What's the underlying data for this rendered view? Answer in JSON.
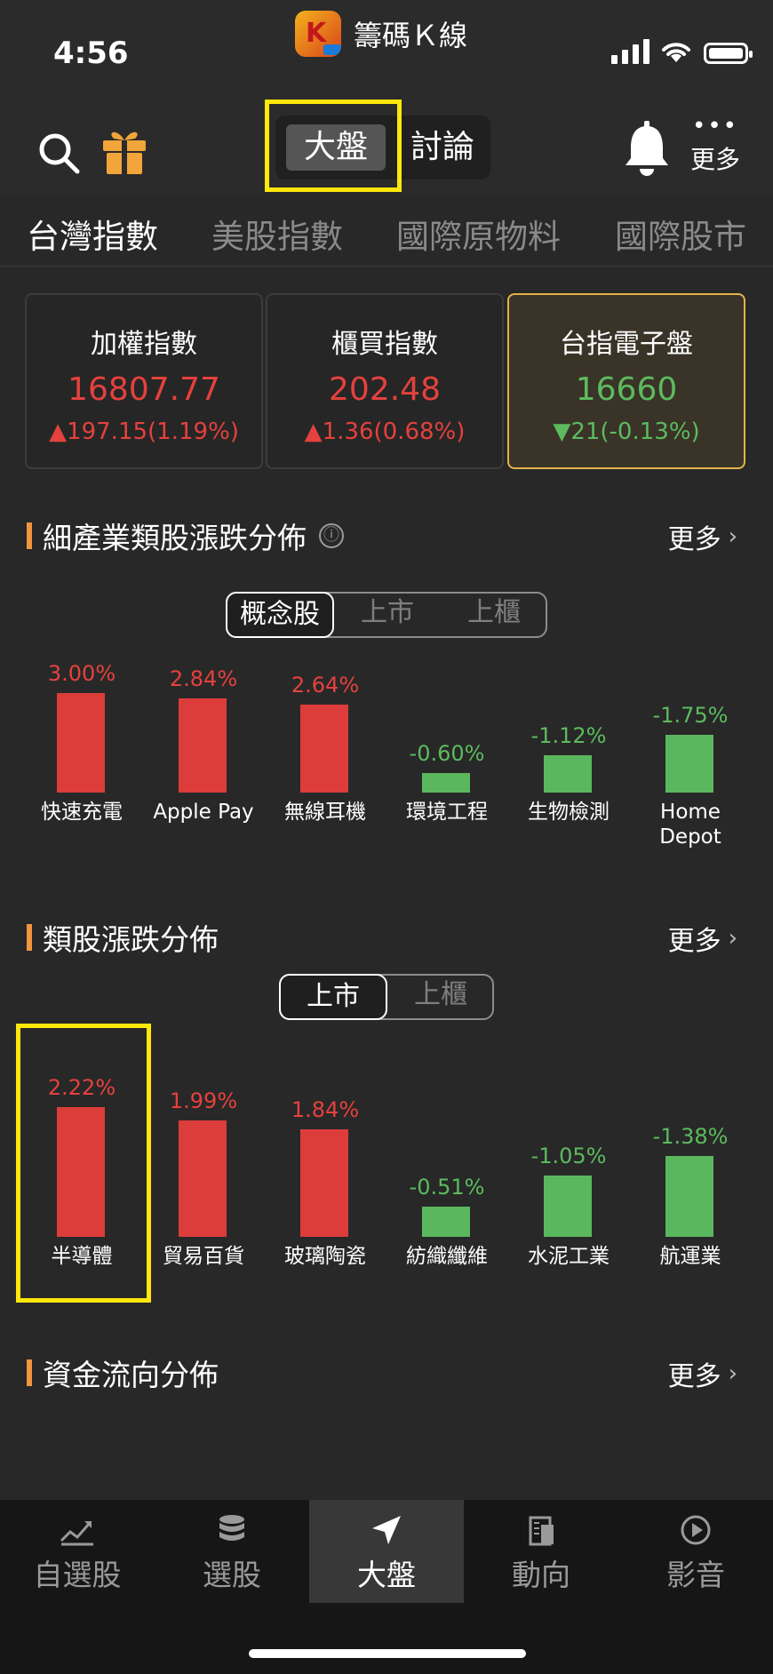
{
  "status": {
    "time": "4:56",
    "app_title": "籌碼Ｋ線",
    "logo_letter": "K"
  },
  "toolbar": {
    "segments": [
      "大盤",
      "討論"
    ],
    "active_segment": "大盤",
    "more_label": "更多",
    "more_dots": "•••"
  },
  "tabs": [
    "台灣指數",
    "美股指數",
    "國際原物料",
    "國際股市"
  ],
  "active_tab": "台灣指數",
  "index_cards": [
    {
      "name": "加權指數",
      "value": "16807.77",
      "change": "▲197.15(1.19%)",
      "direction": "up"
    },
    {
      "name": "櫃買指數",
      "value": "202.48",
      "change": "▲1.36(0.68%)",
      "direction": "up"
    },
    {
      "name": "台指電子盤",
      "value": "16660",
      "change": "▼21(-0.13%)",
      "direction": "down",
      "selected": true
    }
  ],
  "sub_industry": {
    "title": "細產業類股漲跌分佈",
    "info_icon": "ⓘ",
    "more": "更多",
    "chevron": "›",
    "segments": [
      "概念股",
      "上市",
      "上櫃"
    ],
    "active_segment": "概念股",
    "bars": [
      {
        "label": "快速充電",
        "pct": "3.00%",
        "value": 3.0
      },
      {
        "label": "Apple Pay",
        "pct": "2.84%",
        "value": 2.84
      },
      {
        "label": "無線耳機",
        "pct": "2.64%",
        "value": 2.64
      },
      {
        "label": "環境工程",
        "pct": "-0.60%",
        "value": -0.6
      },
      {
        "label": "生物檢測",
        "pct": "-1.12%",
        "value": -1.12
      },
      {
        "label": "Home Depot",
        "pct": "-1.75%",
        "value": -1.75
      }
    ]
  },
  "sector": {
    "title": "類股漲跌分佈",
    "more": "更多",
    "chevron": "›",
    "segments": [
      "上市",
      "上櫃"
    ],
    "active_segment": "上市",
    "bars": [
      {
        "label": "半導體",
        "pct": "2.22%",
        "value": 2.22
      },
      {
        "label": "貿易百貨",
        "pct": "1.99%",
        "value": 1.99
      },
      {
        "label": "玻璃陶瓷",
        "pct": "1.84%",
        "value": 1.84
      },
      {
        "label": "紡織纖維",
        "pct": "-0.51%",
        "value": -0.51
      },
      {
        "label": "水泥工業",
        "pct": "-1.05%",
        "value": -1.05
      },
      {
        "label": "航運業",
        "pct": "-1.38%",
        "value": -1.38
      }
    ]
  },
  "fund_flow": {
    "title": "資金流向分佈",
    "more": "更多",
    "chevron": "›"
  },
  "bottom_nav": [
    {
      "label": "自選股",
      "icon": "chart-icon"
    },
    {
      "label": "選股",
      "icon": "database-icon"
    },
    {
      "label": "大盤",
      "icon": "navigation-arrow-icon",
      "active": true
    },
    {
      "label": "動向",
      "icon": "building-icon"
    },
    {
      "label": "影音",
      "icon": "play-icon"
    }
  ],
  "colors": {
    "up": "#dd3d3a",
    "down": "#5bb75d",
    "highlight": "#ffe80a",
    "accent": "#f0963d",
    "selected_card_border": "#e3b347"
  }
}
